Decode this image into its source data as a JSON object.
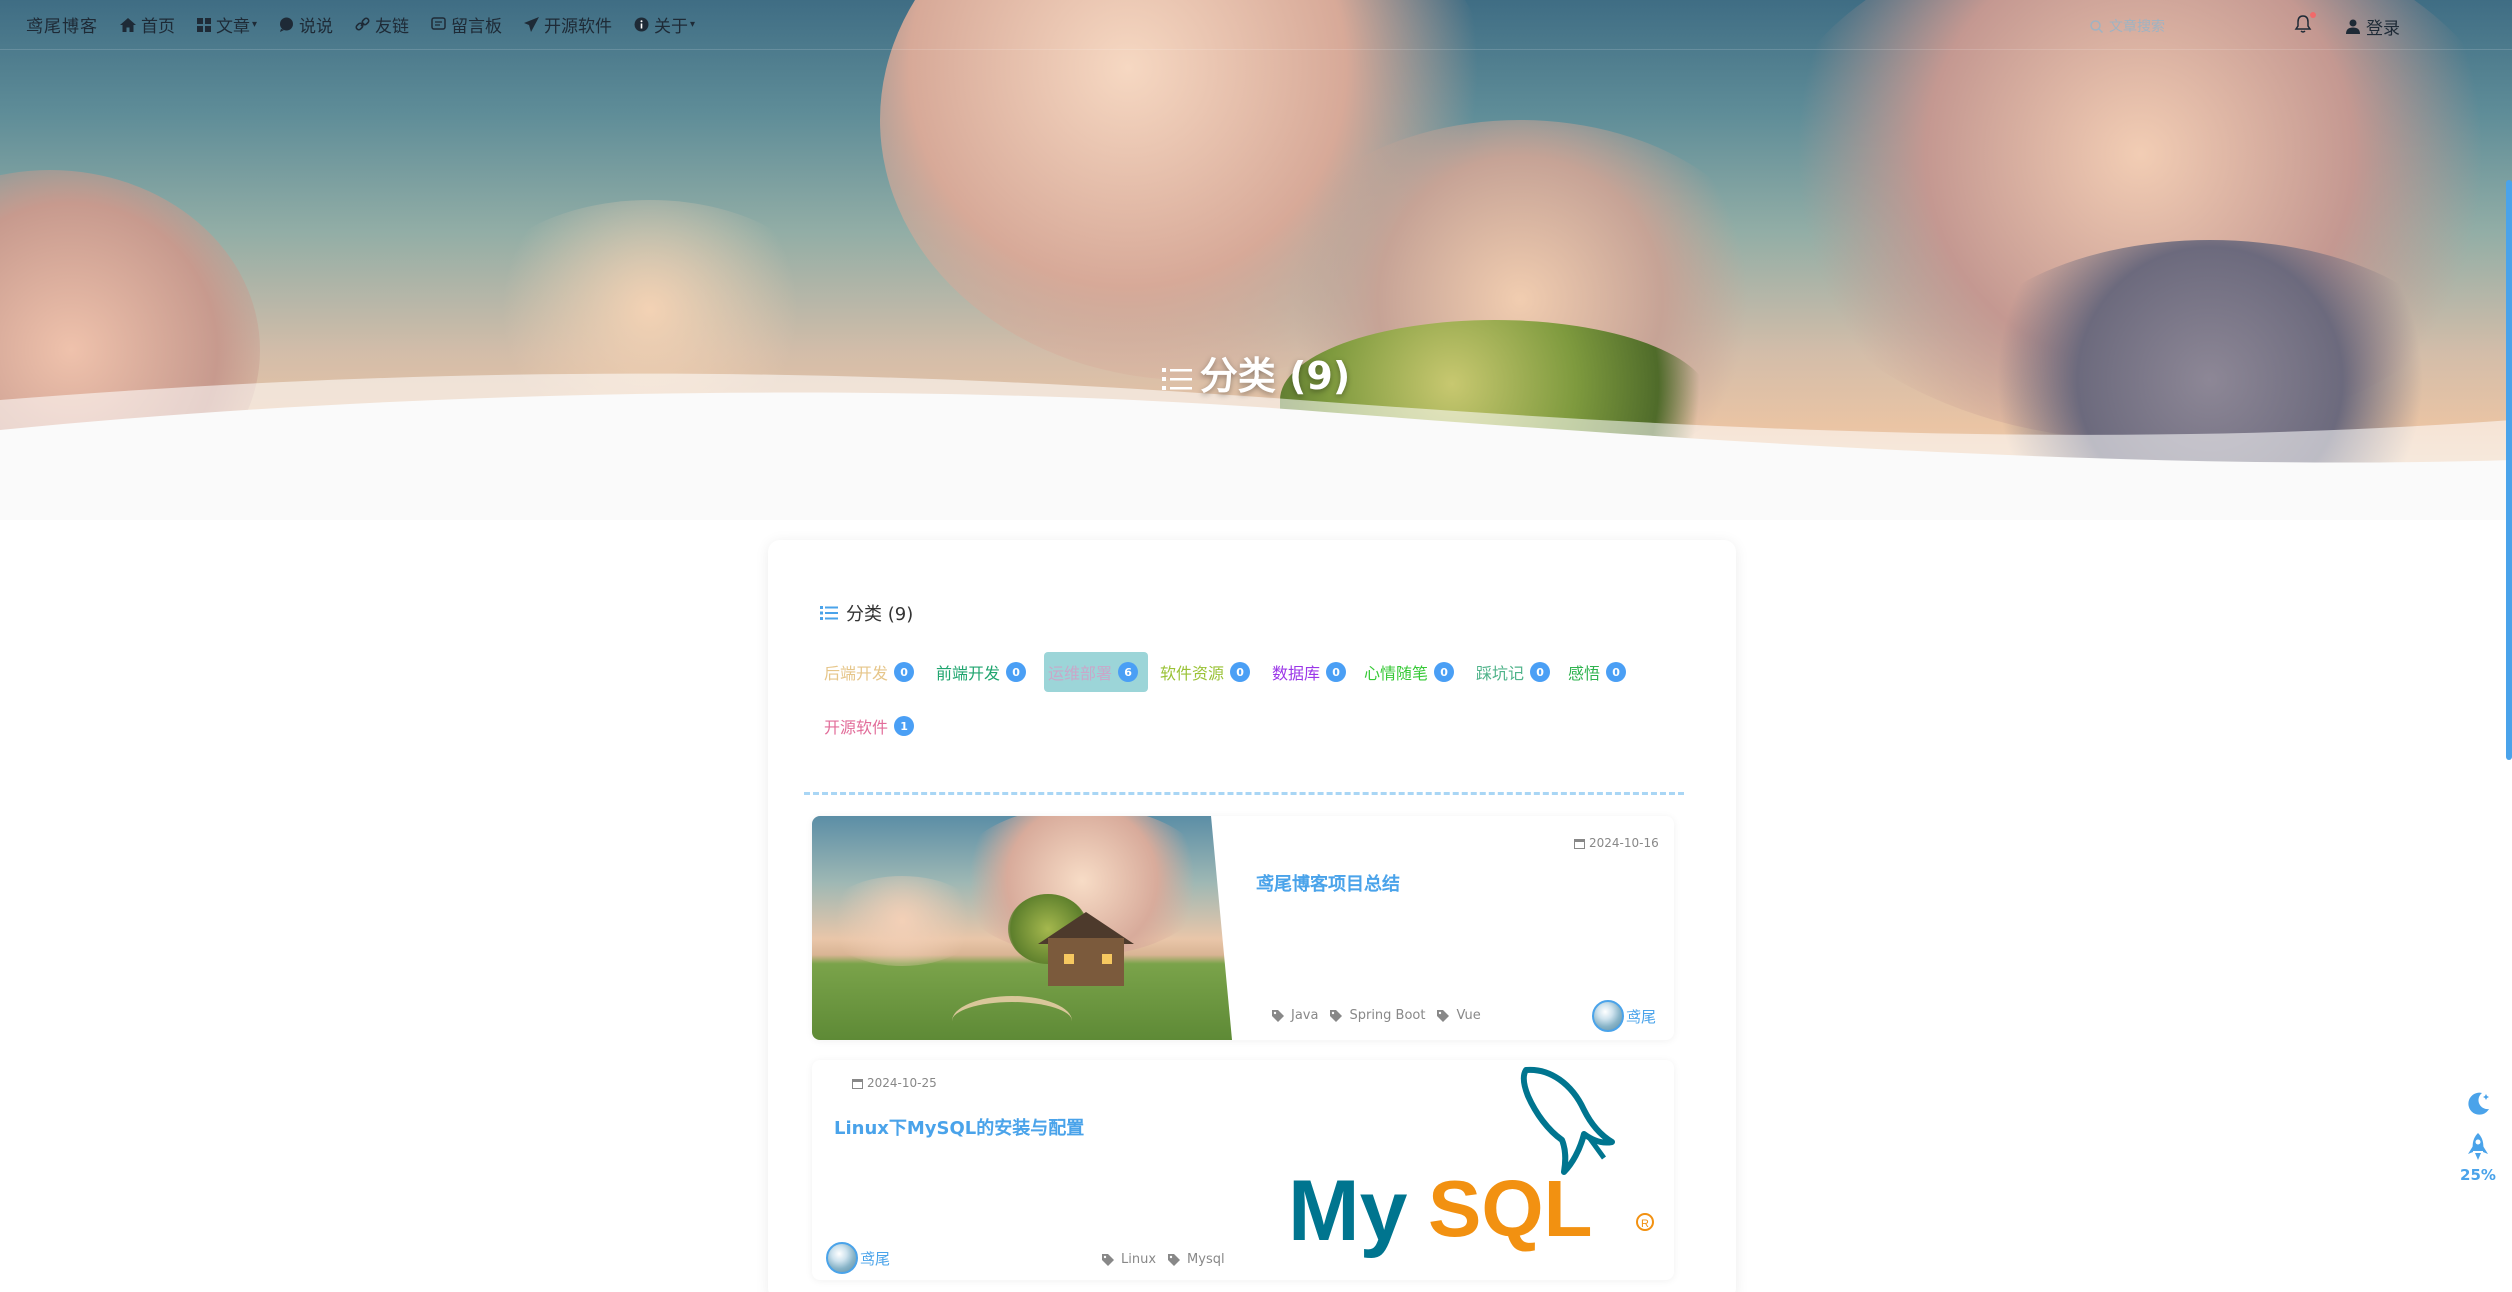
{
  "nav": {
    "brand": "鸢尾博客",
    "items": [
      {
        "label": "首页",
        "icon": "home-icon",
        "dropdown": false
      },
      {
        "label": "文章",
        "icon": "grid-icon",
        "dropdown": true
      },
      {
        "label": "说说",
        "icon": "chat-icon",
        "dropdown": false
      },
      {
        "label": "友链",
        "icon": "link-icon",
        "dropdown": false
      },
      {
        "label": "留言板",
        "icon": "message-board-icon",
        "dropdown": false
      },
      {
        "label": "开源软件",
        "icon": "send-icon",
        "dropdown": false
      },
      {
        "label": "关于",
        "icon": "info-icon",
        "dropdown": true
      }
    ],
    "search_placeholder": "文章搜索",
    "login_label": "登录"
  },
  "hero": {
    "heading": "分类 (9)"
  },
  "categories": {
    "title": "分类 (9)",
    "items": [
      {
        "label": "后端开发",
        "count": "0",
        "color": "#e6c68a",
        "active": false
      },
      {
        "label": "前端开发",
        "count": "0",
        "color": "#20a56f",
        "active": false
      },
      {
        "label": "运维部署",
        "count": "6",
        "color": "#c9a7c9",
        "active": true
      },
      {
        "label": "软件资源",
        "count": "0",
        "color": "#9ac236",
        "active": false
      },
      {
        "label": "数据库",
        "count": "0",
        "color": "#9b37e8",
        "active": false
      },
      {
        "label": "心情随笔",
        "count": "0",
        "color": "#36c936",
        "active": false
      },
      {
        "label": "踩坑记",
        "count": "0",
        "color": "#4fb38a",
        "active": false
      },
      {
        "label": "感悟",
        "count": "0",
        "color": "#2fb34f",
        "active": false
      },
      {
        "label": "开源软件",
        "count": "1",
        "color": "#e26d9a",
        "active": false
      }
    ]
  },
  "posts": [
    {
      "date": "2024-10-16",
      "title": "鸢尾博客项目总结",
      "tags": [
        "Java",
        "Spring Boot",
        "Vue"
      ],
      "author": "鸢尾"
    },
    {
      "date": "2024-10-25",
      "title": "Linux下MySQL的安装与配置",
      "tags": [
        "Linux",
        "Mysql"
      ],
      "author": "鸢尾",
      "logo_text": "MySQL"
    }
  ],
  "float": {
    "scroll_percent": "25%"
  },
  "colors": {
    "accent": "#4aa3ea",
    "badge": "#4a9ff5",
    "mysql_blue": "#00758f",
    "mysql_orange": "#f29111"
  }
}
